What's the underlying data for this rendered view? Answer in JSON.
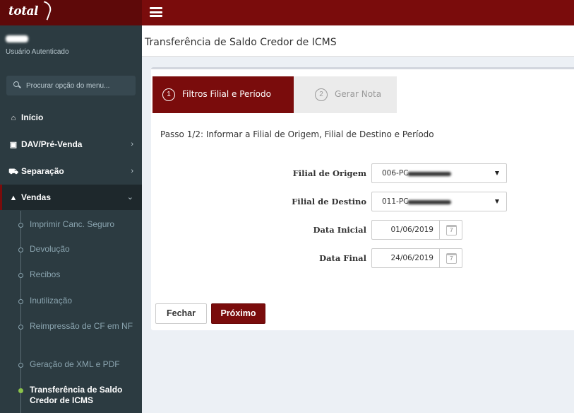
{
  "brand": {
    "logo_text": "total"
  },
  "sidebar": {
    "user_status": "Usuário Autenticado",
    "search_placeholder": "Procurar opção do menu...",
    "menu": [
      {
        "label": "Início",
        "icon": "home-icon"
      },
      {
        "label": "DAV/Pré-Venda",
        "icon": "register-icon"
      },
      {
        "label": "Separação",
        "icon": "truck-icon"
      },
      {
        "label": "Vendas",
        "icon": "shopping-bag-icon"
      }
    ],
    "submenu": [
      "Imprimir Canc. Seguro",
      "Devolução",
      "Recibos",
      "Inutilização",
      "Reimpressão de CF em NF",
      "Geração de XML e PDF",
      "Transferência de Saldo Credor de ICMS"
    ]
  },
  "page": {
    "title": "Transferência de Saldo Credor de ICMS"
  },
  "wizard": {
    "steps": [
      {
        "number": "1",
        "label": "Filtros Filial e Período"
      },
      {
        "number": "2",
        "label": "Gerar Nota"
      }
    ],
    "instruction": "Passo 1/2: Informar a Filial de Origem, Filial de Destino e Período"
  },
  "form": {
    "origin_label": "Filial de Origem",
    "origin_value": "006-PC",
    "destination_label": "Filial de Destino",
    "destination_value": "011-PC",
    "start_label": "Data Inicial",
    "start_value": "01/06/2019",
    "end_label": "Data Final",
    "end_value": "24/06/2019",
    "calendar_day": "7"
  },
  "actions": {
    "close_label": "Fechar",
    "next_label": "Próximo"
  },
  "colors": {
    "primary": "#7a0c0c",
    "sidebar": "#2c3b41"
  }
}
